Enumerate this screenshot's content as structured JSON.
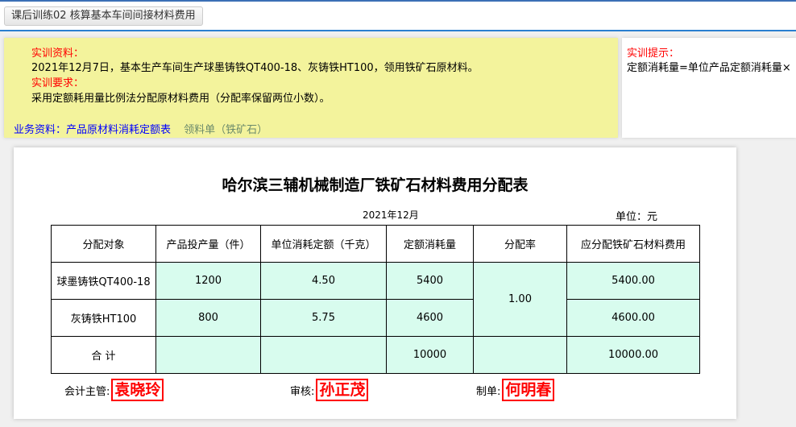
{
  "tab": "课后训练02 核算基本车间间接材料费用",
  "info": {
    "material_label": "实训资料：",
    "material_text": "2021年12月7日，基本生产车间生产球墨铸铁QT400-18、灰铸铁HT100，领用铁矿石原材料。",
    "req_label": "实训要求：",
    "req_text": "采用定额耗用量比例法分配原材料费用（分配率保留两位小数）。",
    "link1": "业务资料：产品原材料消耗定额表",
    "link2": "领料单（铁矿石）"
  },
  "hint": {
    "label": "实训提示：",
    "text": "定额消耗量=单位产品定额消耗量×"
  },
  "sheet": {
    "title": "哈尔滨三辅机械制造厂铁矿石材料费用分配表",
    "date": "2021年12月",
    "unit": "单位：元",
    "headers": [
      "分配对象",
      "产品投产量（件）",
      "单位消耗定额（千克）",
      "定额消耗量",
      "分配率",
      "应分配铁矿石材料费用"
    ],
    "rows": [
      {
        "name": "球墨铸铁QT400-18",
        "qty": "1200",
        "quota": "4.50",
        "consumption": "5400",
        "amount": "5400.00"
      },
      {
        "name": "灰铸铁HT100",
        "qty": "800",
        "quota": "5.75",
        "consumption": "4600",
        "amount": "4600.00"
      }
    ],
    "rate": "1.00",
    "total": {
      "name": "合 计",
      "consumption": "10000",
      "amount": "10000.00"
    },
    "signatures": [
      {
        "label": "会计主管:",
        "name": "袁晓玲"
      },
      {
        "label": "审核:",
        "name": "孙正茂"
      },
      {
        "label": "制单:",
        "name": "何明春"
      }
    ]
  }
}
